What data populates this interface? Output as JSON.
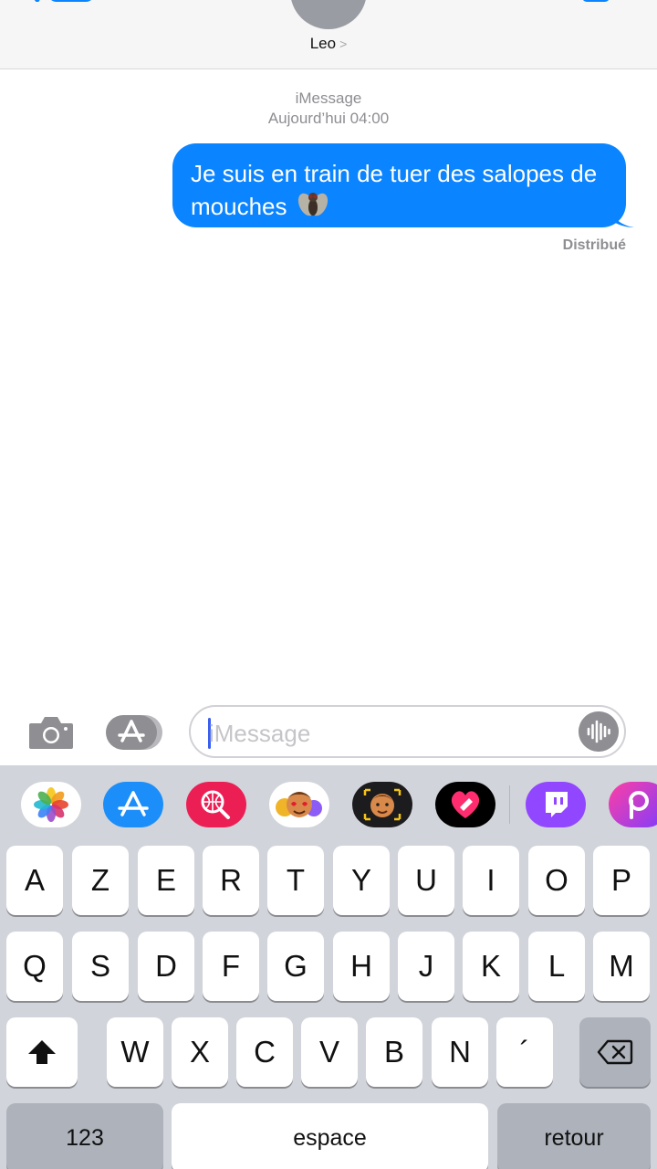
{
  "header": {
    "contact_name": "Leo",
    "contact_chevron": ">"
  },
  "conversation": {
    "service_label": "iMessage",
    "timestamp": "Aujourd’hui 04:00",
    "messages": [
      {
        "text": "Je suis en train de tuer des salopes de mouches",
        "emoji": "fly",
        "direction": "outgoing",
        "status": "Distribué"
      }
    ]
  },
  "composer": {
    "placeholder": "iMessage"
  },
  "app_strip": {
    "apps": [
      "photos-icon",
      "app-store-icon",
      "web-search-icon",
      "memoji-stickers-icon",
      "animoji-icon",
      "digital-touch-icon",
      "twitch-icon",
      "picsart-icon"
    ]
  },
  "keyboard": {
    "row1": [
      "A",
      "Z",
      "E",
      "R",
      "T",
      "Y",
      "U",
      "I",
      "O",
      "P"
    ],
    "row2": [
      "Q",
      "S",
      "D",
      "F",
      "G",
      "H",
      "J",
      "K",
      "L",
      "M"
    ],
    "row3": [
      "W",
      "X",
      "C",
      "V",
      "B",
      "N",
      "´"
    ],
    "numbers_label": "123",
    "space_label": "espace",
    "return_label": "retour"
  },
  "colors": {
    "accent": "#0b84ff",
    "keyboard_bg": "#d1d4da"
  }
}
